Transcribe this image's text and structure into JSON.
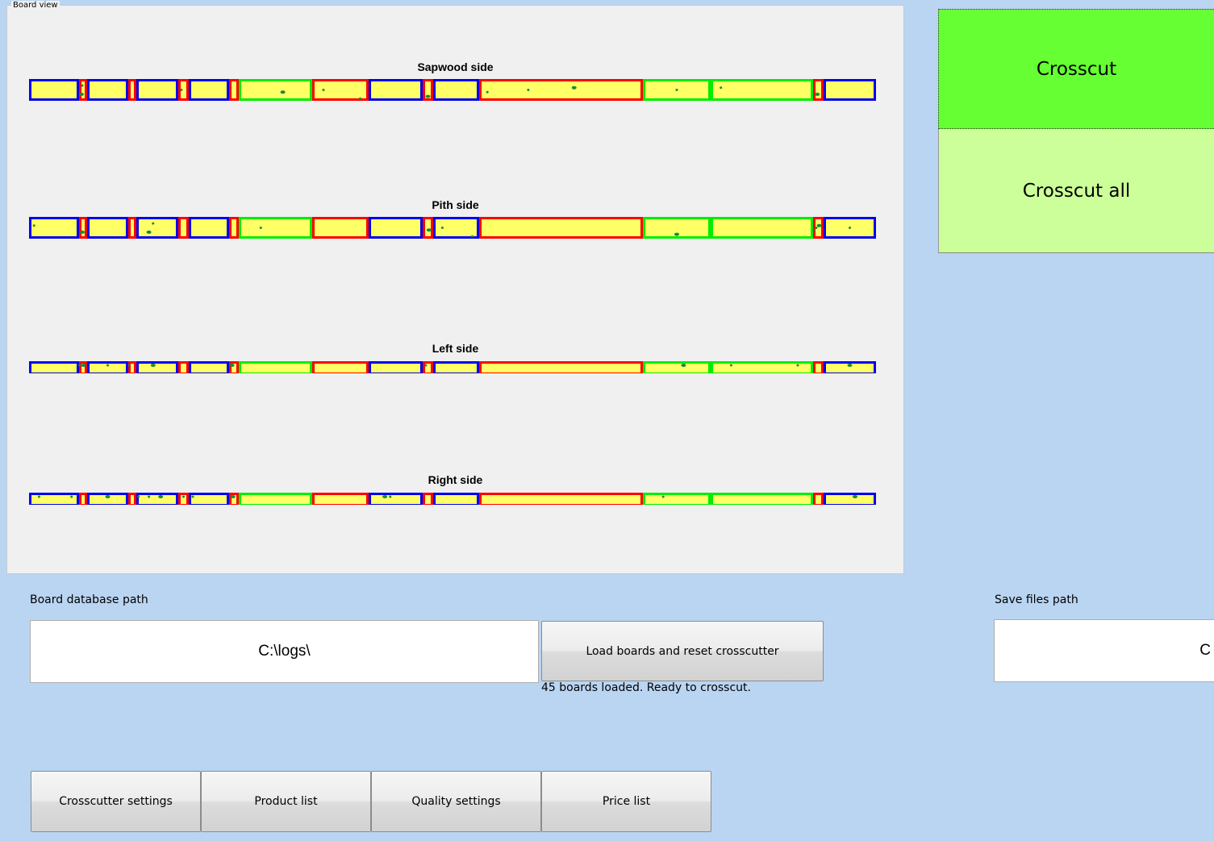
{
  "board_view": {
    "title": "Board view",
    "sides": [
      {
        "name": "Sapwood side",
        "full": true
      },
      {
        "name": "Pith side",
        "full": true
      },
      {
        "name": "Left side",
        "full": false
      },
      {
        "name": "Right side",
        "full": false
      }
    ],
    "segment_colors": {
      "blue": "#0000ee",
      "red": "#ff0000",
      "green": "#00ee00",
      "fill": "#ffff66",
      "defect": "#1a8a3a"
    },
    "segments": [
      {
        "color": "blue",
        "length": 62
      },
      {
        "color": "red",
        "length": 10
      },
      {
        "color": "blue",
        "length": 51
      },
      {
        "color": "red",
        "length": 10
      },
      {
        "color": "blue",
        "length": 52
      },
      {
        "color": "red",
        "length": 13
      },
      {
        "color": "blue",
        "length": 50
      },
      {
        "color": "red",
        "length": 12
      },
      {
        "color": "green",
        "length": 91
      },
      {
        "color": "red",
        "length": 70
      },
      {
        "color": "blue",
        "length": 67
      },
      {
        "color": "red",
        "length": 13
      },
      {
        "color": "blue",
        "length": 57
      },
      {
        "color": "red",
        "length": 203
      },
      {
        "color": "green",
        "length": 84
      },
      {
        "color": "green",
        "length": 127
      },
      {
        "color": "red",
        "length": 13
      },
      {
        "color": "blue",
        "length": 65
      }
    ]
  },
  "actions": {
    "crosscut": "Crosscut",
    "crosscut_all": "Crosscut all",
    "crosscut_color": "#66ff33",
    "crosscut_all_color": "#ccff99"
  },
  "database": {
    "label": "Board database path",
    "value": "C:\\logs\\",
    "load_button": "Load boards and reset crosscutter",
    "status": "45 boards loaded. Ready to crosscut."
  },
  "save": {
    "label": "Save files path",
    "value_visible": "C"
  },
  "bottom_buttons": [
    "Crosscutter settings",
    "Product list",
    "Quality settings",
    "Price list"
  ]
}
